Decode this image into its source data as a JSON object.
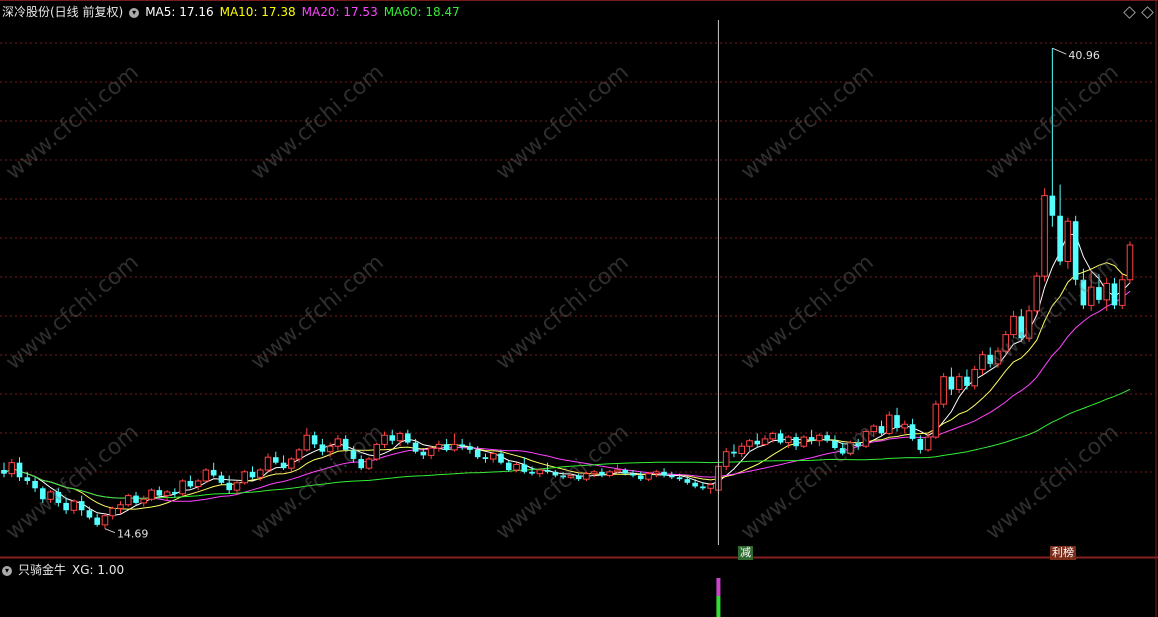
{
  "header": {
    "stock_label": "深冷股份(日线 前复权)",
    "ma_labels": [
      {
        "text": "MA5: 17.16",
        "color": "#ffffff"
      },
      {
        "text": "MA10: 17.38",
        "color": "#ffff00"
      },
      {
        "text": "MA20: 17.53",
        "color": "#ff44ff"
      },
      {
        "text": "MA60: 18.47",
        "color": "#33ee33"
      }
    ]
  },
  "indicator": {
    "label": "只骑金牛",
    "value_label": "XG: 1.00"
  },
  "watermark": "www.cfchi.com",
  "markers": {
    "left_tag": "减",
    "right_tag": "利榜",
    "high_label": "40.96",
    "low_label": "14.69"
  },
  "chart_data": {
    "type": "candlestick",
    "title": "深冷股份(日线 前复权)",
    "ylim": [
      13.8,
      42.5
    ],
    "grid": true,
    "max_high": 40.96,
    "min_low": 14.69,
    "candles": [
      [
        17.9,
        18.3,
        17.5,
        17.7
      ],
      [
        17.7,
        18.5,
        17.5,
        18.3
      ],
      [
        18.3,
        18.6,
        17.3,
        17.5
      ],
      [
        17.5,
        17.8,
        17.1,
        17.3
      ],
      [
        17.3,
        17.5,
        16.7,
        16.9
      ],
      [
        16.9,
        17.0,
        16.1,
        16.3
      ],
      [
        16.3,
        16.8,
        16.1,
        16.7
      ],
      [
        16.7,
        16.9,
        15.9,
        16.1
      ],
      [
        16.1,
        16.4,
        15.5,
        15.7
      ],
      [
        15.7,
        16.3,
        15.5,
        16.2
      ],
      [
        16.2,
        16.5,
        15.4,
        15.7
      ],
      [
        15.7,
        15.9,
        15.2,
        15.3
      ],
      [
        15.3,
        15.5,
        14.8,
        14.9
      ],
      [
        14.9,
        15.5,
        14.69,
        15.4
      ],
      [
        15.4,
        15.9,
        15.2,
        15.8
      ],
      [
        15.8,
        16.2,
        15.5,
        16.0
      ],
      [
        16.0,
        16.6,
        15.9,
        16.5
      ],
      [
        16.5,
        16.7,
        16.0,
        16.1
      ],
      [
        16.1,
        16.5,
        15.9,
        16.3
      ],
      [
        16.3,
        16.9,
        16.2,
        16.8
      ],
      [
        16.8,
        17.0,
        16.4,
        16.5
      ],
      [
        16.5,
        16.8,
        16.2,
        16.7
      ],
      [
        16.7,
        16.9,
        16.4,
        16.6
      ],
      [
        16.6,
        17.4,
        16.5,
        17.3
      ],
      [
        17.3,
        17.6,
        16.9,
        17.0
      ],
      [
        17.0,
        17.4,
        16.8,
        17.3
      ],
      [
        17.3,
        18.0,
        17.2,
        17.9
      ],
      [
        17.9,
        18.3,
        17.5,
        17.6
      ],
      [
        17.6,
        17.8,
        17.1,
        17.2
      ],
      [
        17.2,
        17.6,
        16.6,
        16.8
      ],
      [
        16.8,
        17.3,
        16.6,
        17.2
      ],
      [
        17.2,
        17.9,
        17.1,
        17.8
      ],
      [
        17.8,
        18.1,
        17.4,
        17.5
      ],
      [
        17.5,
        18.0,
        17.3,
        17.9
      ],
      [
        17.9,
        18.8,
        17.8,
        18.6
      ],
      [
        18.6,
        18.9,
        18.2,
        18.3
      ],
      [
        18.3,
        18.7,
        17.9,
        18.0
      ],
      [
        18.0,
        18.6,
        17.8,
        18.5
      ],
      [
        18.5,
        19.1,
        18.3,
        19.0
      ],
      [
        19.0,
        20.2,
        18.9,
        19.8
      ],
      [
        19.8,
        20.0,
        19.1,
        19.3
      ],
      [
        19.3,
        19.6,
        18.7,
        18.9
      ],
      [
        18.9,
        19.4,
        18.6,
        19.2
      ],
      [
        19.2,
        19.8,
        19.0,
        19.6
      ],
      [
        19.6,
        19.8,
        18.9,
        19.0
      ],
      [
        19.0,
        19.2,
        18.3,
        18.5
      ],
      [
        18.5,
        18.7,
        17.9,
        18.0
      ],
      [
        18.0,
        18.6,
        17.9,
        18.5
      ],
      [
        18.5,
        19.4,
        18.4,
        19.3
      ],
      [
        19.3,
        20.0,
        19.1,
        19.8
      ],
      [
        19.8,
        20.1,
        19.3,
        19.5
      ],
      [
        19.5,
        20.0,
        19.2,
        19.9
      ],
      [
        19.9,
        20.1,
        19.3,
        19.4
      ],
      [
        19.4,
        19.6,
        18.8,
        18.9
      ],
      [
        18.9,
        19.1,
        18.5,
        18.7
      ],
      [
        18.7,
        19.2,
        18.5,
        19.1
      ],
      [
        19.1,
        19.5,
        18.9,
        19.3
      ],
      [
        19.3,
        19.6,
        18.9,
        19.0
      ],
      [
        19.0,
        19.9,
        18.9,
        19.3
      ],
      [
        19.3,
        19.6,
        19.0,
        19.2
      ],
      [
        19.2,
        19.4,
        18.8,
        19.0
      ],
      [
        19.0,
        19.2,
        18.5,
        18.6
      ],
      [
        18.6,
        18.8,
        18.3,
        18.5
      ],
      [
        18.5,
        18.9,
        18.3,
        18.8
      ],
      [
        18.8,
        19.0,
        18.2,
        18.3
      ],
      [
        18.3,
        18.4,
        17.8,
        17.9
      ],
      [
        17.9,
        18.3,
        17.8,
        18.2
      ],
      [
        18.2,
        18.6,
        17.7,
        17.8
      ],
      [
        17.8,
        18.1,
        17.6,
        17.7
      ],
      [
        17.7,
        18.0,
        17.5,
        17.9
      ],
      [
        17.9,
        18.3,
        17.7,
        17.8
      ],
      [
        17.8,
        17.9,
        17.5,
        17.6
      ],
      [
        17.6,
        17.8,
        17.4,
        17.5
      ],
      [
        17.5,
        17.7,
        17.4,
        17.6
      ],
      [
        17.6,
        17.7,
        17.3,
        17.4
      ],
      [
        17.4,
        17.8,
        17.3,
        17.7
      ],
      [
        17.7,
        17.9,
        17.5,
        17.8
      ],
      [
        17.8,
        18.0,
        17.5,
        17.6
      ],
      [
        17.6,
        17.9,
        17.5,
        17.8
      ],
      [
        17.8,
        18.2,
        17.7,
        17.9
      ],
      [
        17.9,
        18.0,
        17.6,
        17.7
      ],
      [
        17.7,
        17.9,
        17.5,
        17.6
      ],
      [
        17.6,
        17.8,
        17.3,
        17.4
      ],
      [
        17.4,
        17.8,
        17.3,
        17.7
      ],
      [
        17.7,
        17.9,
        17.5,
        17.8
      ],
      [
        17.8,
        18.0,
        17.5,
        17.6
      ],
      [
        17.6,
        17.8,
        17.4,
        17.5
      ],
      [
        17.5,
        17.7,
        17.3,
        17.4
      ],
      [
        17.4,
        17.6,
        17.1,
        17.2
      ],
      [
        17.2,
        17.4,
        16.9,
        17.0
      ],
      [
        17.0,
        17.2,
        16.8,
        16.9
      ],
      [
        16.9,
        17.2,
        16.6,
        17.1
      ],
      [
        16.8,
        18.2,
        16.6,
        18.1
      ],
      [
        18.1,
        19.1,
        17.9,
        18.9
      ],
      [
        18.9,
        19.3,
        18.6,
        18.8
      ],
      [
        18.8,
        19.4,
        18.6,
        19.2
      ],
      [
        19.2,
        19.6,
        18.9,
        19.5
      ],
      [
        19.5,
        19.9,
        19.1,
        19.3
      ],
      [
        19.3,
        19.8,
        19.2,
        19.6
      ],
      [
        19.6,
        20.0,
        19.4,
        19.9
      ],
      [
        19.9,
        20.1,
        19.3,
        19.4
      ],
      [
        19.4,
        19.8,
        19.1,
        19.7
      ],
      [
        19.7,
        19.9,
        19.0,
        19.2
      ],
      [
        19.2,
        19.8,
        19.1,
        19.7
      ],
      [
        19.7,
        20.1,
        19.3,
        19.5
      ],
      [
        19.5,
        19.9,
        19.2,
        19.8
      ],
      [
        19.8,
        20.0,
        19.4,
        19.5
      ],
      [
        19.5,
        19.8,
        19.0,
        19.1
      ],
      [
        19.1,
        19.4,
        18.7,
        18.8
      ],
      [
        18.8,
        19.5,
        18.7,
        19.4
      ],
      [
        19.4,
        19.6,
        19.0,
        19.2
      ],
      [
        19.2,
        20.1,
        19.1,
        20.0
      ],
      [
        20.0,
        20.4,
        19.7,
        20.3
      ],
      [
        20.3,
        20.6,
        19.8,
        19.9
      ],
      [
        19.9,
        21.1,
        19.8,
        20.9
      ],
      [
        20.9,
        21.3,
        20.0,
        20.2
      ],
      [
        20.2,
        20.6,
        19.9,
        20.4
      ],
      [
        20.4,
        20.7,
        19.5,
        19.6
      ],
      [
        19.6,
        19.8,
        18.8,
        19.0
      ],
      [
        19.0,
        19.9,
        18.9,
        19.7
      ],
      [
        19.7,
        21.7,
        19.6,
        21.5
      ],
      [
        21.5,
        23.2,
        21.3,
        23.0
      ],
      [
        23.0,
        23.5,
        22.0,
        22.3
      ],
      [
        22.3,
        23.2,
        22.1,
        23.0
      ],
      [
        23.0,
        23.4,
        22.3,
        22.5
      ],
      [
        22.5,
        23.6,
        22.3,
        23.4
      ],
      [
        23.4,
        24.4,
        23.1,
        24.2
      ],
      [
        24.2,
        24.6,
        23.5,
        23.7
      ],
      [
        23.7,
        24.6,
        23.5,
        24.4
      ],
      [
        24.4,
        25.5,
        24.2,
        25.3
      ],
      [
        25.3,
        26.6,
        25.1,
        26.3
      ],
      [
        26.3,
        26.7,
        24.9,
        25.1
      ],
      [
        25.1,
        26.9,
        24.9,
        26.6
      ],
      [
        26.6,
        28.7,
        26.4,
        28.5
      ],
      [
        28.5,
        33.3,
        28.2,
        32.9
      ],
      [
        32.9,
        40.96,
        31.2,
        31.8
      ],
      [
        31.8,
        33.5,
        29.1,
        29.3
      ],
      [
        29.3,
        31.7,
        28.9,
        31.5
      ],
      [
        31.5,
        31.8,
        28.0,
        28.3
      ],
      [
        28.3,
        28.9,
        26.7,
        26.9
      ],
      [
        26.9,
        28.8,
        26.6,
        27.9
      ],
      [
        27.9,
        28.6,
        27.0,
        27.2
      ],
      [
        27.2,
        28.4,
        26.6,
        28.1
      ],
      [
        28.1,
        28.4,
        26.7,
        26.9
      ],
      [
        26.9,
        28.6,
        26.7,
        28.3
      ],
      [
        28.3,
        30.4,
        28.1,
        30.2
      ]
    ]
  }
}
